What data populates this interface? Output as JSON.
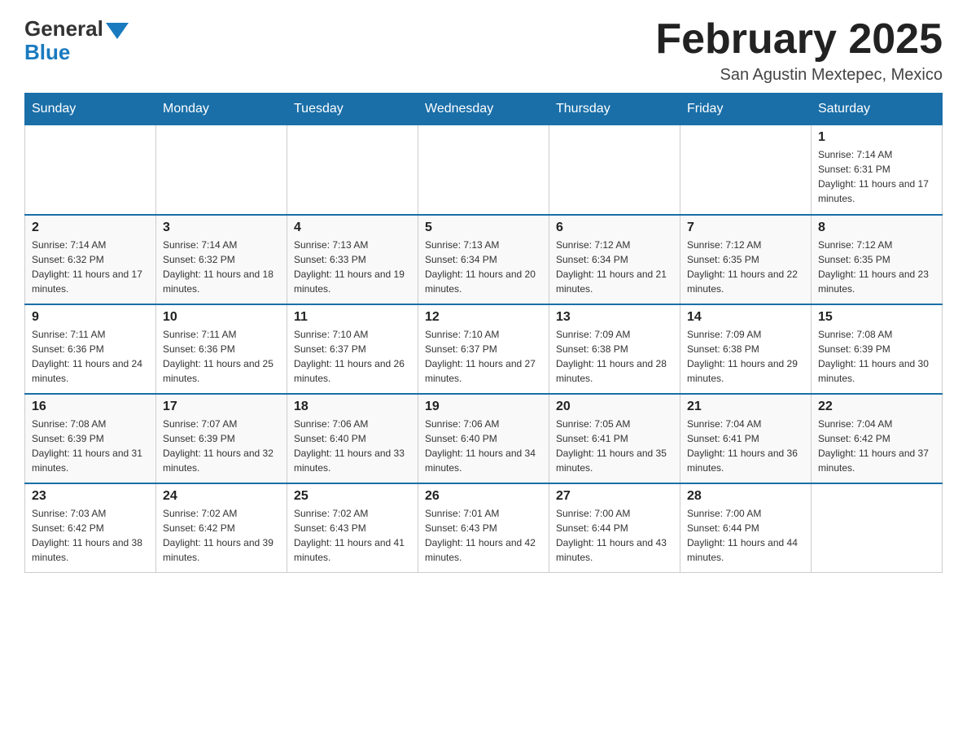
{
  "header": {
    "logo_general": "General",
    "logo_blue": "Blue",
    "title": "February 2025",
    "location": "San Agustin Mextepec, Mexico"
  },
  "days_of_week": [
    "Sunday",
    "Monday",
    "Tuesday",
    "Wednesday",
    "Thursday",
    "Friday",
    "Saturday"
  ],
  "weeks": [
    [
      {
        "day": "",
        "info": ""
      },
      {
        "day": "",
        "info": ""
      },
      {
        "day": "",
        "info": ""
      },
      {
        "day": "",
        "info": ""
      },
      {
        "day": "",
        "info": ""
      },
      {
        "day": "",
        "info": ""
      },
      {
        "day": "1",
        "info": "Sunrise: 7:14 AM\nSunset: 6:31 PM\nDaylight: 11 hours and 17 minutes."
      }
    ],
    [
      {
        "day": "2",
        "info": "Sunrise: 7:14 AM\nSunset: 6:32 PM\nDaylight: 11 hours and 17 minutes."
      },
      {
        "day": "3",
        "info": "Sunrise: 7:14 AM\nSunset: 6:32 PM\nDaylight: 11 hours and 18 minutes."
      },
      {
        "day": "4",
        "info": "Sunrise: 7:13 AM\nSunset: 6:33 PM\nDaylight: 11 hours and 19 minutes."
      },
      {
        "day": "5",
        "info": "Sunrise: 7:13 AM\nSunset: 6:34 PM\nDaylight: 11 hours and 20 minutes."
      },
      {
        "day": "6",
        "info": "Sunrise: 7:12 AM\nSunset: 6:34 PM\nDaylight: 11 hours and 21 minutes."
      },
      {
        "day": "7",
        "info": "Sunrise: 7:12 AM\nSunset: 6:35 PM\nDaylight: 11 hours and 22 minutes."
      },
      {
        "day": "8",
        "info": "Sunrise: 7:12 AM\nSunset: 6:35 PM\nDaylight: 11 hours and 23 minutes."
      }
    ],
    [
      {
        "day": "9",
        "info": "Sunrise: 7:11 AM\nSunset: 6:36 PM\nDaylight: 11 hours and 24 minutes."
      },
      {
        "day": "10",
        "info": "Sunrise: 7:11 AM\nSunset: 6:36 PM\nDaylight: 11 hours and 25 minutes."
      },
      {
        "day": "11",
        "info": "Sunrise: 7:10 AM\nSunset: 6:37 PM\nDaylight: 11 hours and 26 minutes."
      },
      {
        "day": "12",
        "info": "Sunrise: 7:10 AM\nSunset: 6:37 PM\nDaylight: 11 hours and 27 minutes."
      },
      {
        "day": "13",
        "info": "Sunrise: 7:09 AM\nSunset: 6:38 PM\nDaylight: 11 hours and 28 minutes."
      },
      {
        "day": "14",
        "info": "Sunrise: 7:09 AM\nSunset: 6:38 PM\nDaylight: 11 hours and 29 minutes."
      },
      {
        "day": "15",
        "info": "Sunrise: 7:08 AM\nSunset: 6:39 PM\nDaylight: 11 hours and 30 minutes."
      }
    ],
    [
      {
        "day": "16",
        "info": "Sunrise: 7:08 AM\nSunset: 6:39 PM\nDaylight: 11 hours and 31 minutes."
      },
      {
        "day": "17",
        "info": "Sunrise: 7:07 AM\nSunset: 6:39 PM\nDaylight: 11 hours and 32 minutes."
      },
      {
        "day": "18",
        "info": "Sunrise: 7:06 AM\nSunset: 6:40 PM\nDaylight: 11 hours and 33 minutes."
      },
      {
        "day": "19",
        "info": "Sunrise: 7:06 AM\nSunset: 6:40 PM\nDaylight: 11 hours and 34 minutes."
      },
      {
        "day": "20",
        "info": "Sunrise: 7:05 AM\nSunset: 6:41 PM\nDaylight: 11 hours and 35 minutes."
      },
      {
        "day": "21",
        "info": "Sunrise: 7:04 AM\nSunset: 6:41 PM\nDaylight: 11 hours and 36 minutes."
      },
      {
        "day": "22",
        "info": "Sunrise: 7:04 AM\nSunset: 6:42 PM\nDaylight: 11 hours and 37 minutes."
      }
    ],
    [
      {
        "day": "23",
        "info": "Sunrise: 7:03 AM\nSunset: 6:42 PM\nDaylight: 11 hours and 38 minutes."
      },
      {
        "day": "24",
        "info": "Sunrise: 7:02 AM\nSunset: 6:42 PM\nDaylight: 11 hours and 39 minutes."
      },
      {
        "day": "25",
        "info": "Sunrise: 7:02 AM\nSunset: 6:43 PM\nDaylight: 11 hours and 41 minutes."
      },
      {
        "day": "26",
        "info": "Sunrise: 7:01 AM\nSunset: 6:43 PM\nDaylight: 11 hours and 42 minutes."
      },
      {
        "day": "27",
        "info": "Sunrise: 7:00 AM\nSunset: 6:44 PM\nDaylight: 11 hours and 43 minutes."
      },
      {
        "day": "28",
        "info": "Sunrise: 7:00 AM\nSunset: 6:44 PM\nDaylight: 11 hours and 44 minutes."
      },
      {
        "day": "",
        "info": ""
      }
    ]
  ]
}
